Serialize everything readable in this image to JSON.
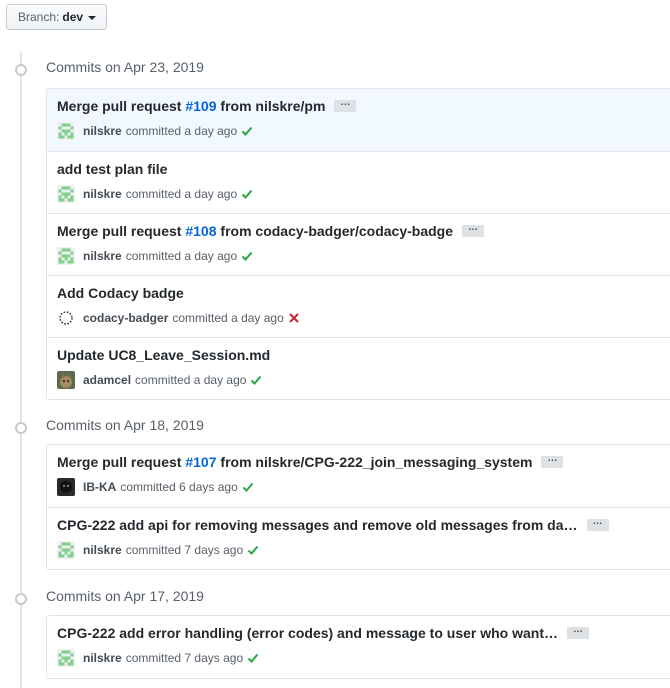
{
  "branch": {
    "prefix": "Branch:",
    "name": "dev"
  },
  "groups": [
    {
      "title": "Commits on Apr 23, 2019",
      "commits": [
        {
          "msg_before": "Merge pull request ",
          "issue": "#109",
          "msg_after": " from nilskre/pm",
          "has_ellipsis": true,
          "author": "nilskre",
          "action": "committed",
          "time": "a day ago",
          "status": "success",
          "avatar": "identicon-green"
        },
        {
          "msg_before": "add test plan file",
          "issue": "",
          "msg_after": "",
          "has_ellipsis": false,
          "author": "nilskre",
          "action": "committed",
          "time": "a day ago",
          "status": "success",
          "avatar": "identicon-green"
        },
        {
          "msg_before": "Merge pull request ",
          "issue": "#108",
          "msg_after": " from codacy-badger/codacy-badge",
          "has_ellipsis": true,
          "author": "nilskre",
          "action": "committed",
          "time": "a day ago",
          "status": "success",
          "avatar": "identicon-green"
        },
        {
          "msg_before": "Add Codacy badge",
          "issue": "",
          "msg_after": "",
          "has_ellipsis": false,
          "author": "codacy-badger",
          "action": "committed",
          "time": "a day ago",
          "status": "failure",
          "avatar": "codacy"
        },
        {
          "msg_before": "Update UC8_Leave_Session.md",
          "issue": "",
          "msg_after": "",
          "has_ellipsis": false,
          "author": "adamcel",
          "action": "committed",
          "time": "a day ago",
          "status": "success",
          "avatar": "photo-cat"
        }
      ]
    },
    {
      "title": "Commits on Apr 18, 2019",
      "commits": [
        {
          "msg_before": "Merge pull request ",
          "issue": "#107",
          "msg_after": " from nilskre/CPG-222_join_messaging_system",
          "has_ellipsis": true,
          "author": "IB-KA",
          "action": "committed",
          "time": "6 days ago",
          "status": "success",
          "avatar": "photo-dark"
        },
        {
          "msg_before": "CPG-222 add api for removing messages and remove old messages from da…",
          "issue": "",
          "msg_after": "",
          "has_ellipsis": true,
          "author": "nilskre",
          "action": "committed",
          "time": "7 days ago",
          "status": "success",
          "avatar": "identicon-green"
        }
      ]
    },
    {
      "title": "Commits on Apr 17, 2019",
      "commits": [
        {
          "msg_before": "CPG-222 add error handling (error codes) and message to user who want…",
          "issue": "",
          "msg_after": "",
          "has_ellipsis": true,
          "author": "nilskre",
          "action": "committed",
          "time": "7 days ago",
          "status": "success",
          "avatar": "identicon-green"
        }
      ]
    }
  ],
  "ellipsis_label": "…",
  "colors": {
    "link": "#0366d6",
    "success": "#28a745",
    "failure": "#cb2431",
    "identicon": "#7fcf8f"
  }
}
